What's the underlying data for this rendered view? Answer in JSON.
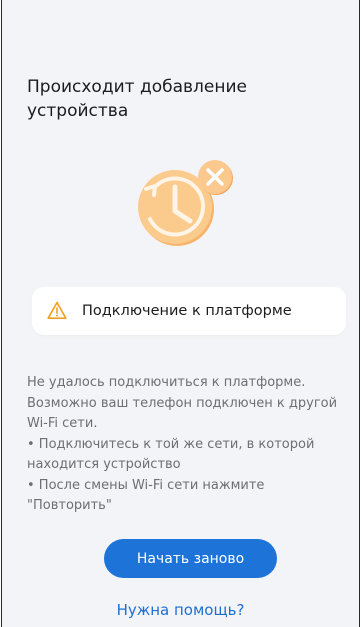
{
  "header": {
    "title": "Происходит добавление устройства"
  },
  "illustration": {
    "icon": "clock-error-icon"
  },
  "status_card": {
    "icon": "warning-icon",
    "text": "Подключение к платформе"
  },
  "message": {
    "intro": "Не удалось подключиться к платформе. Возможно ваш телефон подключен к другой Wi-Fi сети.",
    "tip1": " • Подключитесь к той же сети, в которой находится устройство",
    "tip2": " • После смены Wi-Fi сети нажмите \"Повторить\""
  },
  "actions": {
    "restart_label": "Начать заново",
    "help_label": "Нужна помощь?"
  },
  "colors": {
    "accent": "#1d73d8",
    "warning": "#f0a020",
    "illustration": "#f7b36a"
  }
}
